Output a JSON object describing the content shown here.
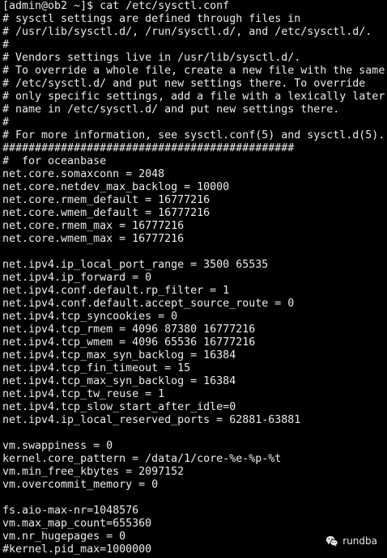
{
  "terminal": {
    "lines": [
      "[admin@ob2 ~]$ cat /etc/sysctl.conf",
      "# sysctl settings are defined through files in",
      "# /usr/lib/sysctl.d/, /run/sysctl.d/, and /etc/sysctl.d/.",
      "#",
      "# Vendors settings live in /usr/lib/sysctl.d/.",
      "# To override a whole file, create a new file with the same",
      "# /etc/sysctl.d/ and put new settings there. To override",
      "# only specific settings, add a file with a lexically later",
      "# name in /etc/sysctl.d/ and put new settings there.",
      "#",
      "# For more information, see sysctl.conf(5) and sysctl.d(5).",
      "#############################################",
      "#  for oceanbase",
      "net.core.somaxconn = 2048",
      "net.core.netdev_max_backlog = 10000",
      "net.core.rmem_default = 16777216",
      "net.core.wmem_default = 16777216",
      "net.core.rmem_max = 16777216",
      "net.core.wmem_max = 16777216",
      "",
      "net.ipv4.ip_local_port_range = 3500 65535",
      "net.ipv4.ip_forward = 0",
      "net.ipv4.conf.default.rp_filter = 1",
      "net.ipv4.conf.default.accept_source_route = 0",
      "net.ipv4.tcp_syncookies = 0",
      "net.ipv4.tcp_rmem = 4096 87380 16777216",
      "net.ipv4.tcp_wmem = 4096 65536 16777216",
      "net.ipv4.tcp_max_syn_backlog = 16384",
      "net.ipv4.tcp_fin_timeout = 15",
      "net.ipv4.tcp_max_syn_backlog = 16384",
      "net.ipv4.tcp_tw_reuse = 1",
      "net.ipv4.tcp_slow_start_after_idle=0",
      "net.ipv4.ip_local_reserved_ports = 62881-63881",
      "",
      "vm.swappiness = 0",
      "kernel.core_pattern = /data/1/core-%e-%p-%t",
      "vm.min_free_kbytes = 2097152",
      "vm.overcommit_memory = 0",
      "",
      "fs.aio-max-nr=1048576",
      "vm.max_map_count=655360",
      "vm.nr_hugepages = 0",
      "#kernel.pid_max=1000000"
    ]
  },
  "watermark": {
    "icon": "wechat-icon",
    "text": "rundba",
    "color": "#e6e6e6"
  },
  "colors": {
    "background": "#000000",
    "foreground": "#ececec"
  }
}
